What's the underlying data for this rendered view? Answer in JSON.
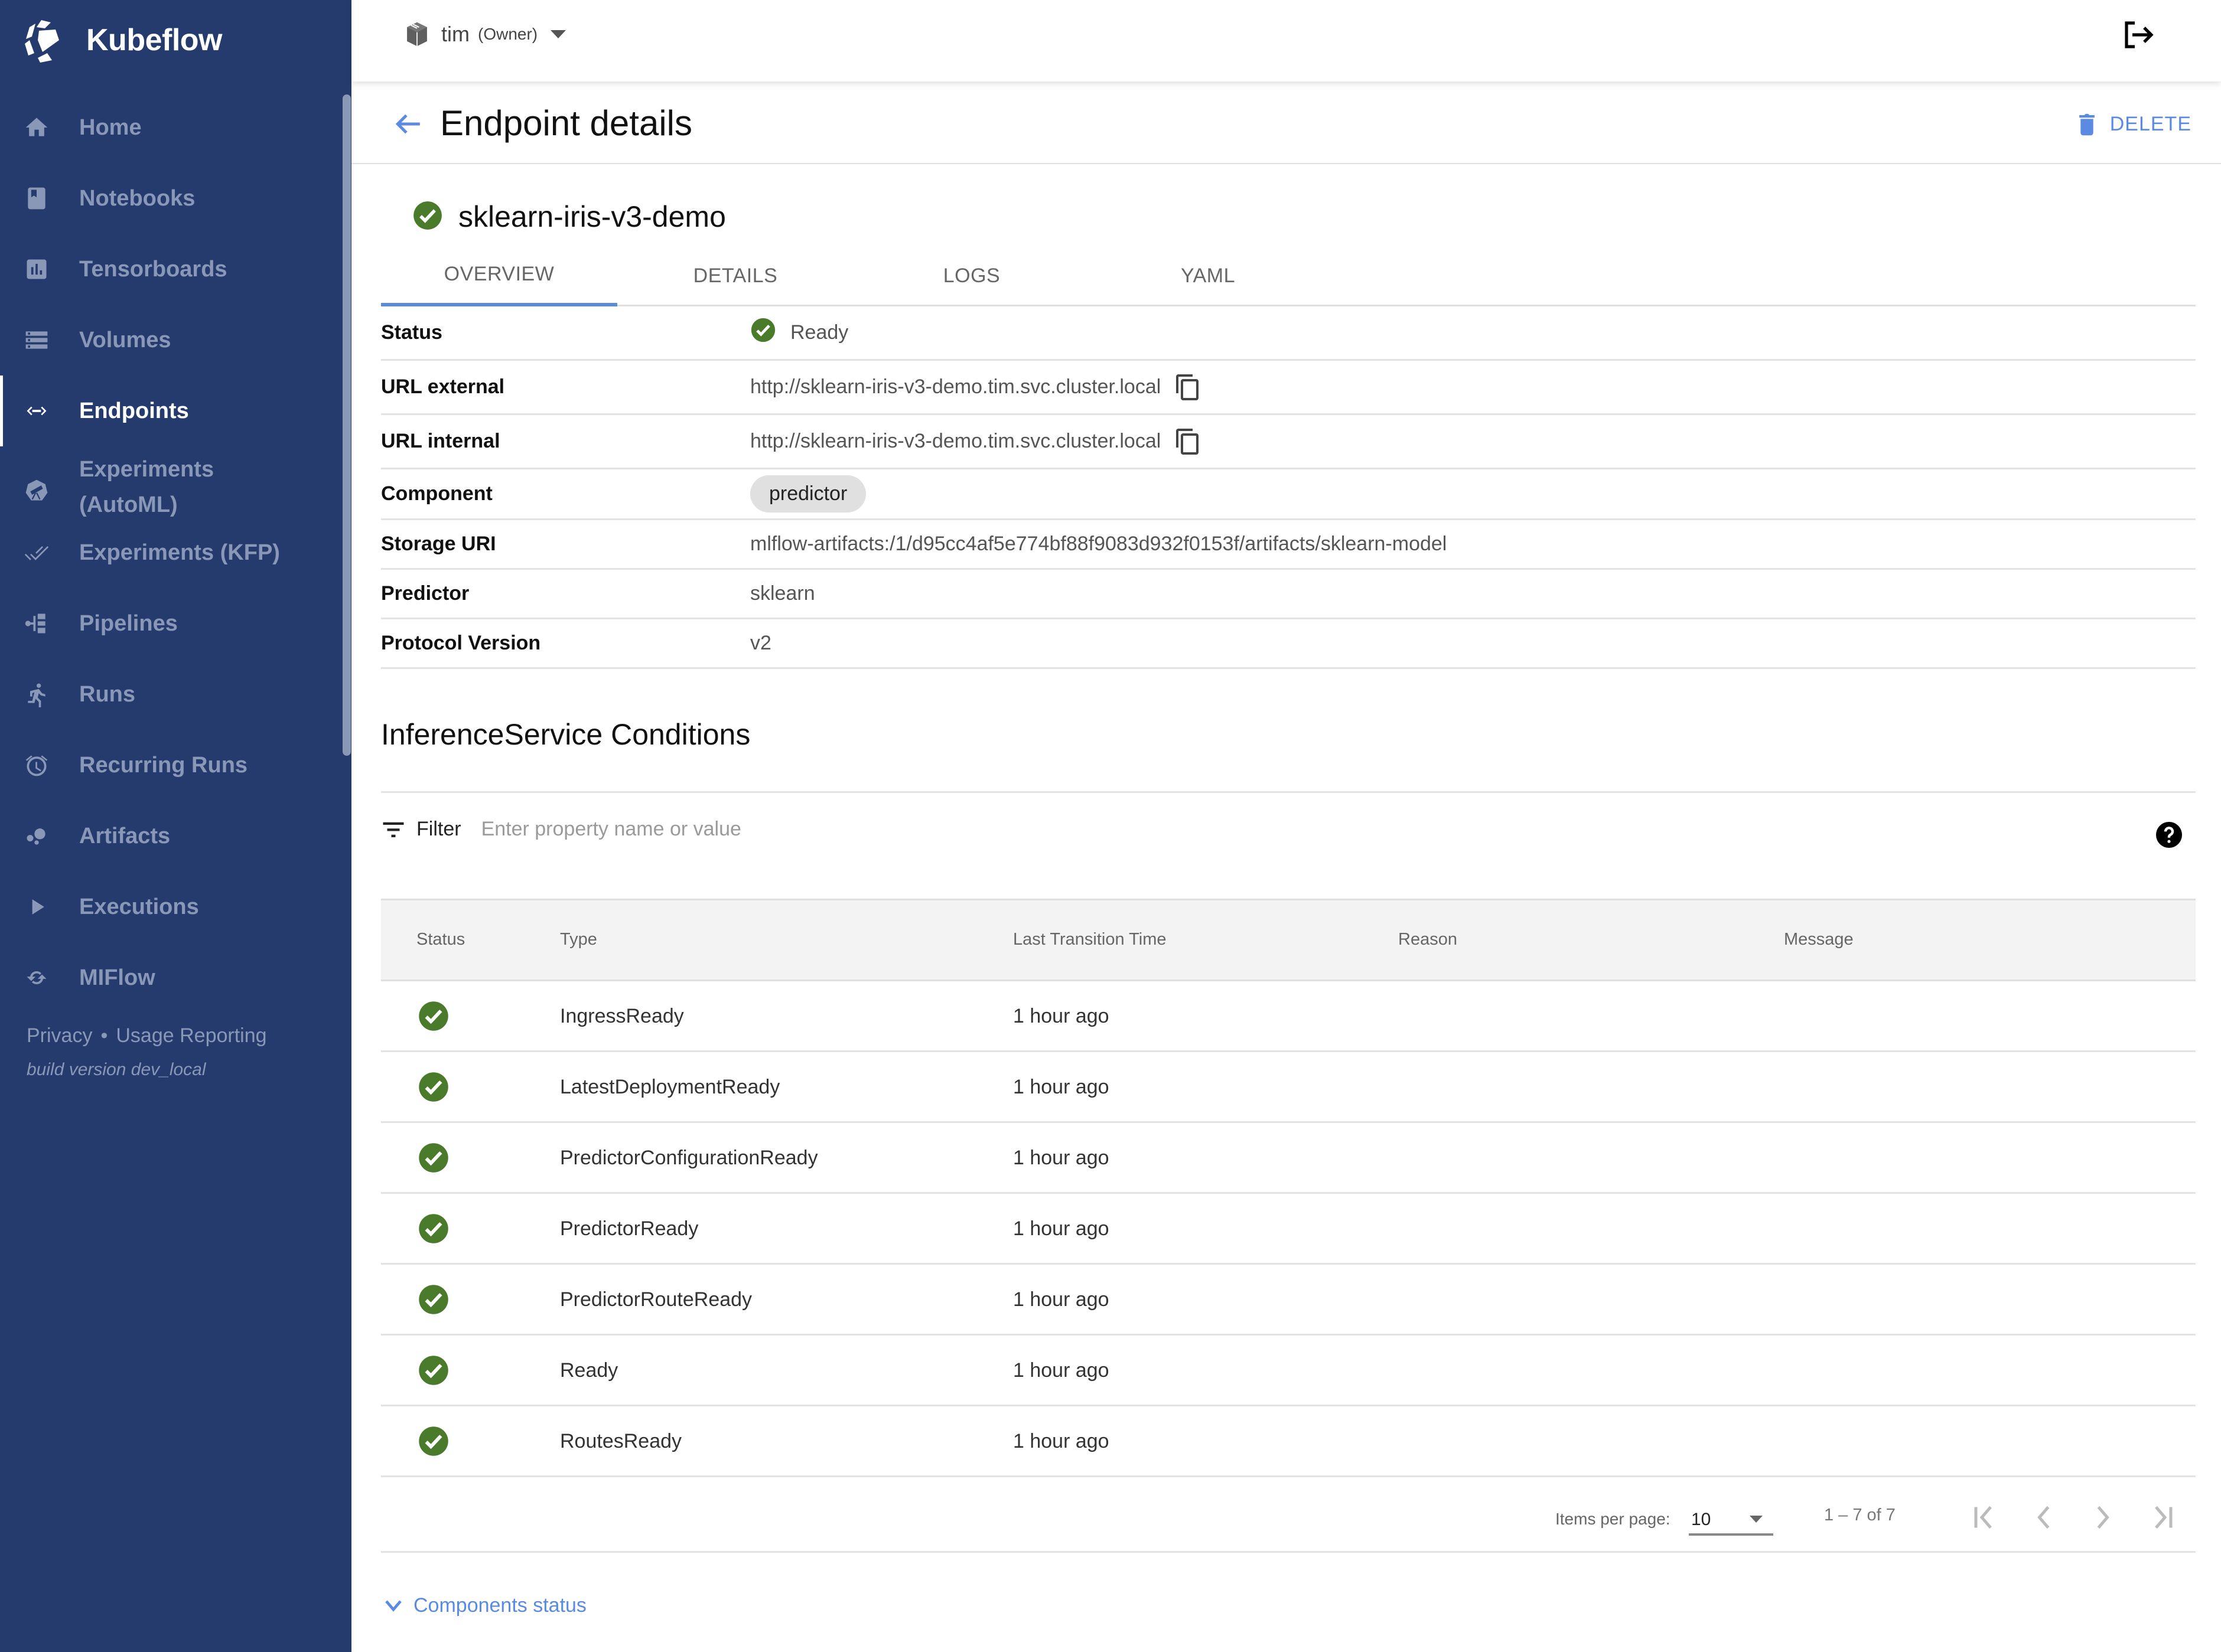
{
  "app": {
    "name": "Kubeflow",
    "accent_color": "#5b8ae2",
    "sidebar_color": "#253b6e",
    "success_color": "#4a7b2a"
  },
  "sidebar": {
    "items": [
      {
        "label": "Home",
        "icon": "home-icon",
        "active": false
      },
      {
        "label": "Notebooks",
        "icon": "notebook-icon",
        "active": false
      },
      {
        "label": "Tensorboards",
        "icon": "tensorboard-icon",
        "active": false
      },
      {
        "label": "Volumes",
        "icon": "volumes-icon",
        "active": false
      },
      {
        "label": "Endpoints",
        "icon": "endpoints-icon",
        "active": true
      },
      {
        "label": "Experiments\n(AutoML)",
        "label_line1": "Experiments",
        "label_line2": "(AutoML)",
        "icon": "telescope-icon",
        "active": false
      },
      {
        "label": "Experiments (KFP)",
        "icon": "double-check-icon",
        "active": false
      },
      {
        "label": "Pipelines",
        "icon": "pipelines-icon",
        "active": false
      },
      {
        "label": "Runs",
        "icon": "runner-icon",
        "active": false
      },
      {
        "label": "Recurring Runs",
        "icon": "alarm-icon",
        "active": false
      },
      {
        "label": "Artifacts",
        "icon": "artifacts-icon",
        "active": false
      },
      {
        "label": "Executions",
        "icon": "play-icon",
        "active": false
      },
      {
        "label": "MIFlow",
        "icon": "sync-icon",
        "active": false
      }
    ],
    "footer": {
      "privacy": "Privacy",
      "separator": "•",
      "usage_reporting": "Usage Reporting",
      "build_version": "build version dev_local"
    }
  },
  "topbar": {
    "namespace": "tim",
    "role": "(Owner)"
  },
  "header": {
    "title": "Endpoint details",
    "delete_label": "DELETE"
  },
  "resource": {
    "name": "sklearn-iris-v3-demo",
    "status": "ready"
  },
  "tabs": [
    {
      "label": "OVERVIEW",
      "active": true
    },
    {
      "label": "DETAILS",
      "active": false
    },
    {
      "label": "LOGS",
      "active": false
    },
    {
      "label": "YAML",
      "active": false
    }
  ],
  "overview": {
    "rows": [
      {
        "label": "Status",
        "value": "Ready"
      },
      {
        "label": "URL external",
        "value": "http://sklearn-iris-v3-demo.tim.svc.cluster.local"
      },
      {
        "label": "URL internal",
        "value": "http://sklearn-iris-v3-demo.tim.svc.cluster.local"
      },
      {
        "label": "Component",
        "value": "predictor"
      },
      {
        "label": "Storage URI",
        "value": "mlflow-artifacts:/1/d95cc4af5e774bf88f9083d932f0153f/artifacts/sklearn-model"
      },
      {
        "label": "Predictor",
        "value": "sklearn"
      },
      {
        "label": "Protocol Version",
        "value": "v2"
      }
    ]
  },
  "conditions": {
    "title": "InferenceService Conditions",
    "filter_label": "Filter",
    "filter_placeholder": "Enter property name or value",
    "filter_value": "",
    "columns": [
      "Status",
      "Type",
      "Last Transition Time",
      "Reason",
      "Message"
    ],
    "rows": [
      {
        "status": "ready",
        "type": "IngressReady",
        "time": "1 hour ago",
        "reason": "",
        "message": ""
      },
      {
        "status": "ready",
        "type": "LatestDeploymentReady",
        "time": "1 hour ago",
        "reason": "",
        "message": ""
      },
      {
        "status": "ready",
        "type": "PredictorConfigurationReady",
        "time": "1 hour ago",
        "reason": "",
        "message": ""
      },
      {
        "status": "ready",
        "type": "PredictorReady",
        "time": "1 hour ago",
        "reason": "",
        "message": ""
      },
      {
        "status": "ready",
        "type": "PredictorRouteReady",
        "time": "1 hour ago",
        "reason": "",
        "message": ""
      },
      {
        "status": "ready",
        "type": "Ready",
        "time": "1 hour ago",
        "reason": "",
        "message": ""
      },
      {
        "status": "ready",
        "type": "RoutesReady",
        "time": "1 hour ago",
        "reason": "",
        "message": ""
      }
    ],
    "pagination": {
      "items_per_page_label": "Items per page:",
      "items_per_page": "10",
      "range": "1 – 7 of 7"
    }
  },
  "components_status": {
    "label": "Components status"
  }
}
